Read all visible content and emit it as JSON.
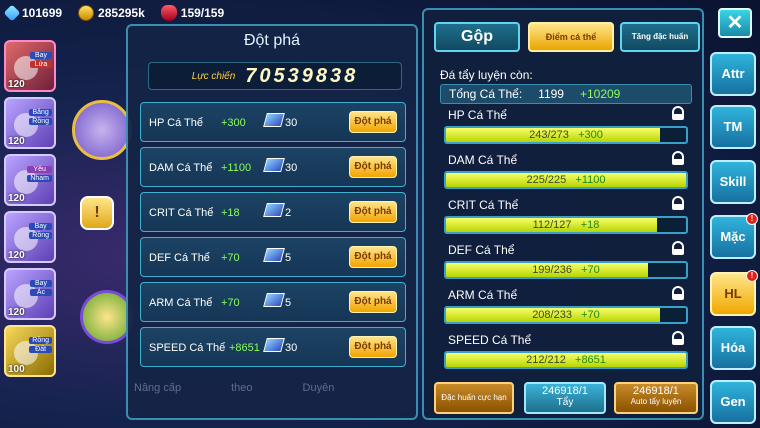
{
  "topbar": {
    "diamonds": "101699",
    "gold": "285295k",
    "stamina": "159/159"
  },
  "party": [
    {
      "level": "120",
      "tags": [
        "Bay",
        "Lửa"
      ],
      "tag_colors": [
        "",
        "red"
      ]
    },
    {
      "level": "120",
      "tags": [
        "Băng",
        "Rồng"
      ],
      "tag_colors": [
        "",
        ""
      ]
    },
    {
      "level": "120",
      "tags": [
        "Yêu",
        "Nham"
      ],
      "tag_colors": [
        "purple",
        ""
      ]
    },
    {
      "level": "120",
      "tags": [
        "Bay",
        "Rồng"
      ],
      "tag_colors": [
        "",
        ""
      ]
    },
    {
      "level": "120",
      "tags": [
        "Bay",
        "Ác"
      ],
      "tag_colors": [
        "",
        ""
      ]
    },
    {
      "level": "100",
      "tags": [
        "Rồng",
        "Đất"
      ],
      "tag_colors": [
        "",
        ""
      ]
    }
  ],
  "breakthrough": {
    "title": "Đột phá",
    "power_label": "Lực chiến",
    "power_value": "70539838",
    "rows": [
      {
        "name": "HP Cá Thể",
        "bonus": "+300",
        "cost": "30",
        "button": "Đột phá"
      },
      {
        "name": "DAM Cá Thể",
        "bonus": "+1100",
        "cost": "30",
        "button": "Đột phá"
      },
      {
        "name": "CRIT Cá Thể",
        "bonus": "+18",
        "cost": "2",
        "button": "Đột phá"
      },
      {
        "name": "DEF Cá Thể",
        "bonus": "+70",
        "cost": "5",
        "button": "Đột phá"
      },
      {
        "name": "ARM Cá Thể",
        "bonus": "+70",
        "cost": "5",
        "button": "Đột phá"
      },
      {
        "name": "SPEED Cá Thể",
        "bonus": "+8651",
        "cost": "30",
        "button": "Đột phá"
      }
    ],
    "faded_labels": [
      "Nâng cấp",
      "theo",
      "Duyên"
    ]
  },
  "training": {
    "tabs": {
      "gop": "Gộp",
      "diem": "Điểm cá thể",
      "tang": "Tăng đặc huấn"
    },
    "remaining_label": "Đá tẩy luyện còn:",
    "total_label": "Tổng Cá Thể:",
    "total_value": "1199",
    "total_bonus": "+10209",
    "stats": [
      {
        "name": "HP Cá Thể",
        "value": "243/273",
        "bonus": "+300",
        "fill": 0.89
      },
      {
        "name": "DAM Cá Thể",
        "value": "225/225",
        "bonus": "+1100",
        "fill": 1.0
      },
      {
        "name": "CRIT Cá Thể",
        "value": "112/127",
        "bonus": "+18",
        "fill": 0.88
      },
      {
        "name": "DEF Cá Thể",
        "value": "199/236",
        "bonus": "+70",
        "fill": 0.84
      },
      {
        "name": "ARM Cá Thể",
        "value": "208/233",
        "bonus": "+70",
        "fill": 0.89
      },
      {
        "name": "SPEED Cá Thể",
        "value": "212/212",
        "bonus": "+8651",
        "fill": 1.0
      }
    ],
    "buttons": {
      "special": "Đặc huấn cực hạn",
      "wash": "Tẩy",
      "wash_count": "246918/1",
      "auto": "Auto tẩy luyện",
      "auto_count": "246918/1"
    }
  },
  "sidebar": {
    "close": "✕",
    "items": [
      "Attr",
      "TM",
      "Skill",
      "Mặc",
      "HL",
      "Hóa",
      "Gen"
    ],
    "active": "HL",
    "alert_items": [
      "Mặc",
      "HL"
    ]
  }
}
